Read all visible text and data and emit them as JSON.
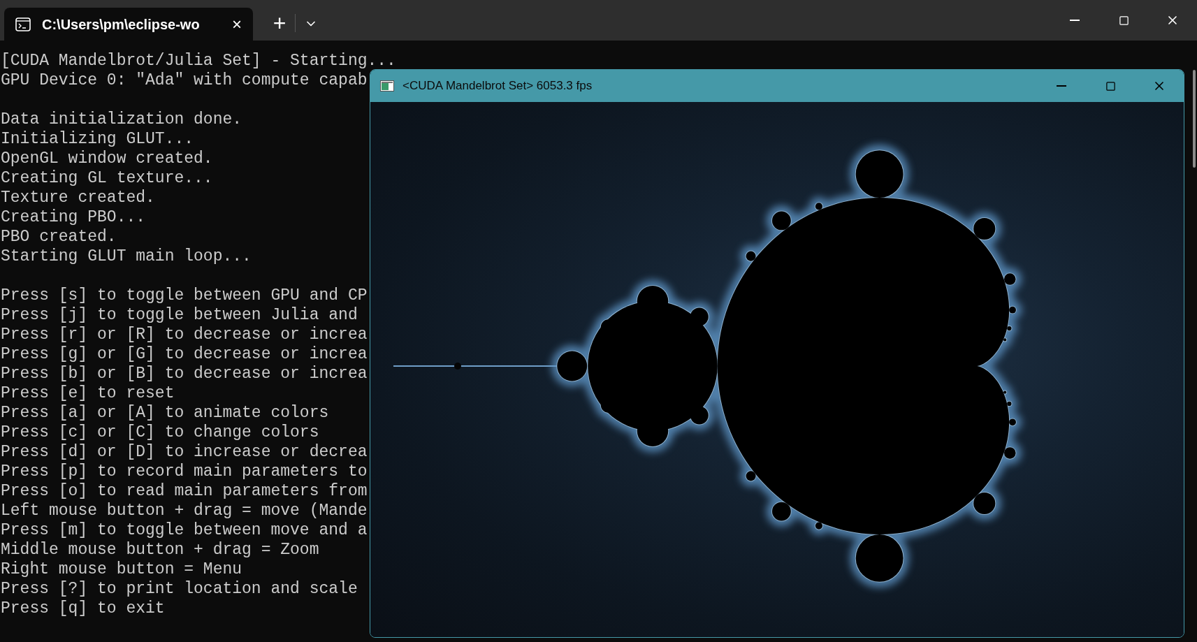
{
  "terminal_tab": {
    "title": "C:\\Users\\pm\\eclipse-wo",
    "selected": true,
    "close": "×"
  },
  "new_tab": "+",
  "console": {
    "paragraphs": [
      [
        "[CUDA Mandelbrot/Julia Set] - Starting...",
        "GPU Device 0: \"Ada\" with compute capab"
      ],
      [
        "Data initialization done.",
        "Initializing GLUT...",
        "OpenGL window created.",
        "Creating GL texture...",
        "Texture created.",
        "Creating PBO...",
        "PBO created.",
        "Starting GLUT main loop..."
      ],
      [
        "Press [s] to toggle between GPU and CP",
        "Press [j] to toggle between Julia and",
        "Press [r] or [R] to decrease or increa",
        "Press [g] or [G] to decrease or increa",
        "Press [b] or [B] to decrease or increa",
        "Press [e] to reset",
        "Press [a] or [A] to animate colors",
        "Press [c] or [C] to change colors",
        "Press [d] or [D] to increase or decrea",
        "Press [p] to record main parameters to",
        "Press [o] to read main parameters from",
        "Left mouse button + drag = move (Mande",
        "Press [m] to toggle between move and a",
        "Middle mouse button + drag = Zoom",
        "Right mouse button = Menu",
        "Press [?] to print location and scale",
        "Press [q] to exit"
      ]
    ]
  },
  "render_window": {
    "title": "<CUDA Mandelbrot Set> 6053.3 fps"
  }
}
